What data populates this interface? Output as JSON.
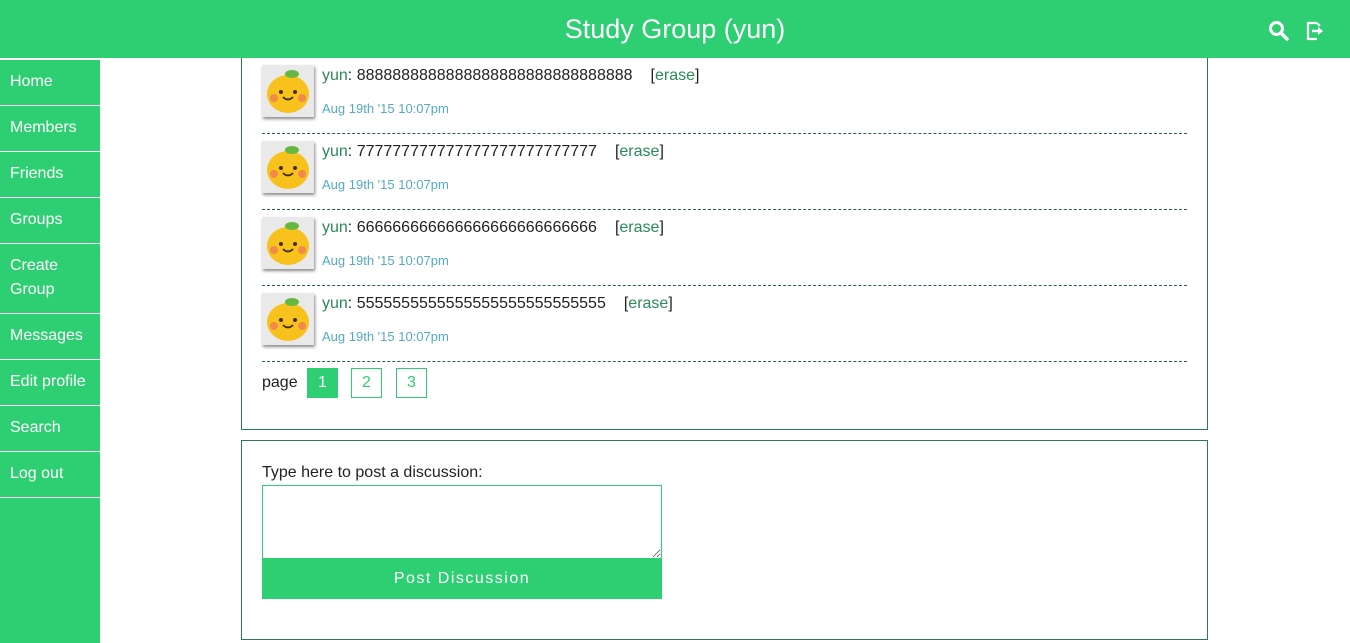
{
  "header": {
    "title": "Study Group (yun)",
    "icons": [
      "search-icon",
      "logout-icon"
    ],
    "accent": "#2ecf72"
  },
  "sidebar": {
    "items": [
      {
        "label": "Home"
      },
      {
        "label": "Members"
      },
      {
        "label": "Friends"
      },
      {
        "label": "Groups"
      },
      {
        "label": "Create Group"
      },
      {
        "label": "Messages"
      },
      {
        "label": "Edit profile"
      },
      {
        "label": "Search"
      },
      {
        "label": "Log out"
      }
    ]
  },
  "posts": [
    {
      "user": "yun",
      "text": "8888888888888888888888888888888",
      "erase": "erase",
      "time": "Aug 19th '15 10:07pm"
    },
    {
      "user": "yun",
      "text": "777777777777777777777777777",
      "erase": "erase",
      "time": "Aug 19th '15 10:07pm"
    },
    {
      "user": "yun",
      "text": "666666666666666666666666666",
      "erase": "erase",
      "time": "Aug 19th '15 10:07pm"
    },
    {
      "user": "yun",
      "text": "5555555555555555555555555555",
      "erase": "erase",
      "time": "Aug 19th '15 10:07pm"
    }
  ],
  "pagination": {
    "label": "page",
    "pages": [
      "1",
      "2",
      "3"
    ],
    "current": "1"
  },
  "form": {
    "label": "Type here to post a discussion:",
    "textarea_value": "",
    "button_label": "Post Discussion"
  }
}
